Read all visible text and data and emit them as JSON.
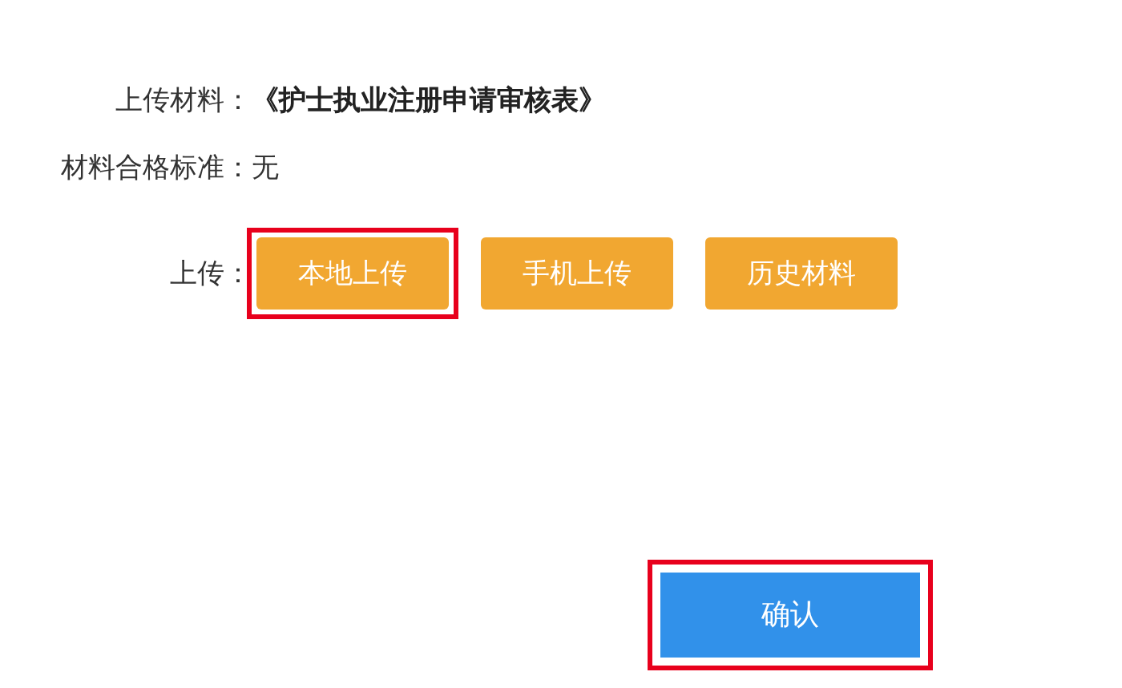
{
  "fields": [
    {
      "label": "上传材料：",
      "value": "《护士执业注册申请审核表》",
      "kind": "title"
    },
    {
      "label": "材料合格标准：",
      "value": "无",
      "kind": "text"
    }
  ],
  "upload": {
    "label": "上传：",
    "buttons": [
      {
        "label": "本地上传",
        "highlighted": true
      },
      {
        "label": "手机上传",
        "highlighted": false
      },
      {
        "label": "历史材料",
        "highlighted": false
      }
    ]
  },
  "confirm": {
    "label": "确认",
    "highlighted": true
  }
}
